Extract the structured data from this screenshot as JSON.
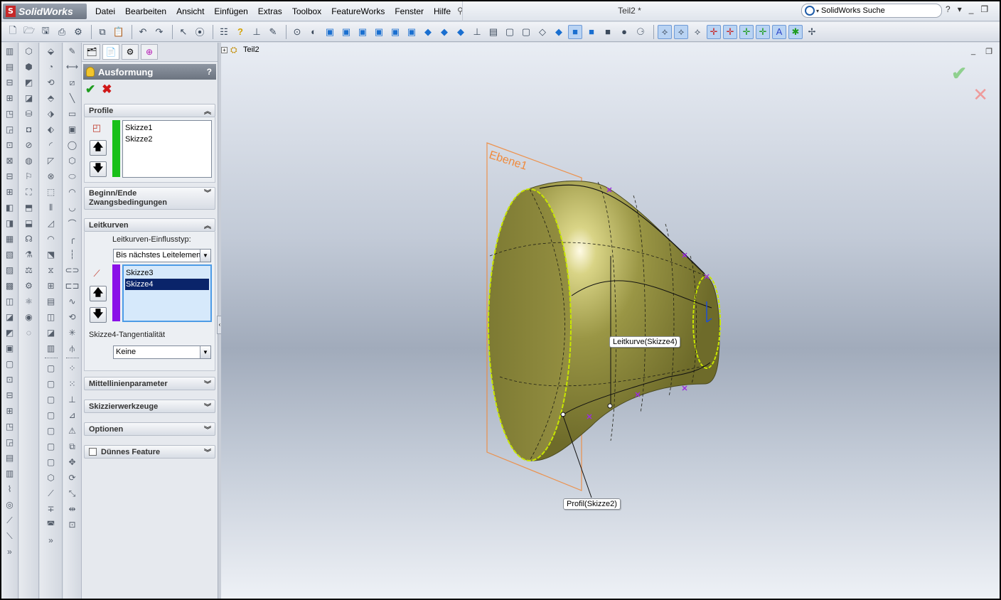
{
  "app": {
    "name": "SolidWorks",
    "doc_title": "Teil2 *"
  },
  "menu": [
    "Datei",
    "Bearbeiten",
    "Ansicht",
    "Einfügen",
    "Extras",
    "Toolbox",
    "FeatureWorks",
    "Fenster",
    "Hilfe"
  ],
  "search": {
    "placeholder": "SolidWorks Suche"
  },
  "window_controls": {
    "help": "?",
    "minimize": "_",
    "restore": "❐"
  },
  "property_manager": {
    "title": "Ausformung",
    "help": "?",
    "groups": {
      "profile": {
        "label": "Profile",
        "items": [
          "Skizze1",
          "Skizze2"
        ],
        "color": "#19c019"
      },
      "start_end": {
        "label": "Beginn/Ende Zwangsbedingungen"
      },
      "guides": {
        "label": "Leitkurven",
        "influence_label": "Leitkurven-Einflusstyp:",
        "influence_value": "Bis nächstes Leitelement",
        "items": [
          "Skizze3",
          "Skizze4"
        ],
        "selected": "Skizze4",
        "color": "#8a10e8",
        "tangency_label": "Skizze4-Tangentialität",
        "tangency_value": "Keine"
      },
      "centerline": {
        "label": "Mittellinienparameter"
      },
      "sketch_tools": {
        "label": "Skizzierwerkzeuge"
      },
      "options": {
        "label": "Optionen"
      },
      "thin": {
        "label": "Dünnes Feature",
        "checked": false
      }
    }
  },
  "graphics": {
    "tree_root": "Teil2",
    "plane_label": "Ebene1",
    "callout_guide": "Leitkurve(Skizze4)",
    "callout_profile": "Profil(Skizze2)",
    "colors": {
      "surface": "#8b8a3a",
      "plane": "#f08a3c",
      "profile_outline": "#c8e600",
      "guide_marker": "#9c2ce0"
    }
  }
}
